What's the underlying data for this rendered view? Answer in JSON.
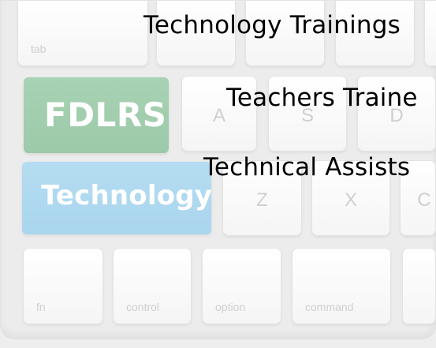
{
  "headlines": [
    "Technology Trainings",
    "Teachers Traine",
    "Technical Assists"
  ],
  "brand_keys": {
    "fdlrs": "FDLRS",
    "technology": "Technology",
    "fdlrs_color": "#9ccaa9",
    "technology_color": "#a9d5ee"
  },
  "keyboard": {
    "top_left": "tab",
    "row_2": [
      "A",
      "S",
      "D"
    ],
    "row_3": [
      "Z",
      "X",
      "C"
    ],
    "bottom": [
      "fn",
      "control",
      "option",
      "command"
    ]
  }
}
